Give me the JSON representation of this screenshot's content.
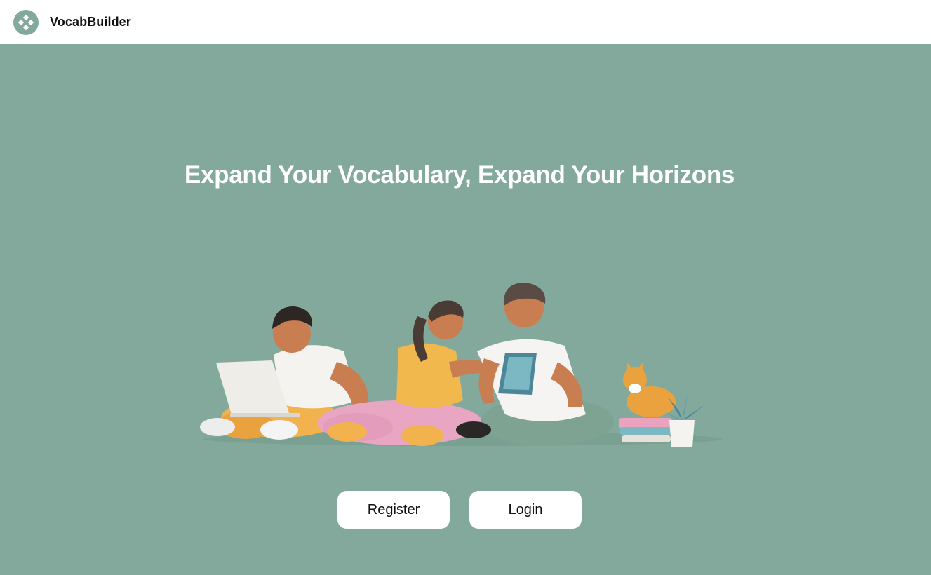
{
  "header": {
    "logo_icon": "diamond-dots-logo",
    "brand_name": "VocabBuilder"
  },
  "hero": {
    "headline": "Expand Your Vocabulary, Expand Your Horizons",
    "illustration": "three-students-studying-with-laptop-tablet-cat-books-plant-illustration"
  },
  "actions": {
    "register_label": "Register",
    "login_label": "Login"
  },
  "colors": {
    "hero_background": "#83A99C",
    "header_background": "#FFFFFF",
    "button_background": "#FFFFFF",
    "logo_circle": "#83A99C"
  }
}
